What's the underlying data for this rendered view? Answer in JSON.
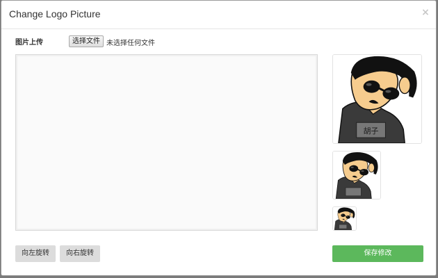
{
  "dialog": {
    "title": "Change Logo Picture",
    "close_glyph": "×"
  },
  "upload": {
    "label": "图片上传",
    "file_button": "选择文件",
    "file_status": "未选择任何文件"
  },
  "preview": {
    "shirt_text": "胡子",
    "sizes": [
      "large",
      "medium",
      "small"
    ]
  },
  "actions": {
    "rotate_left": "向左旋转",
    "rotate_right": "向右旋转",
    "save": "保存修改"
  },
  "colors": {
    "save_button": "#5cb85c",
    "gray_button": "#dcdcdc",
    "crop_background": "#fafafa"
  }
}
